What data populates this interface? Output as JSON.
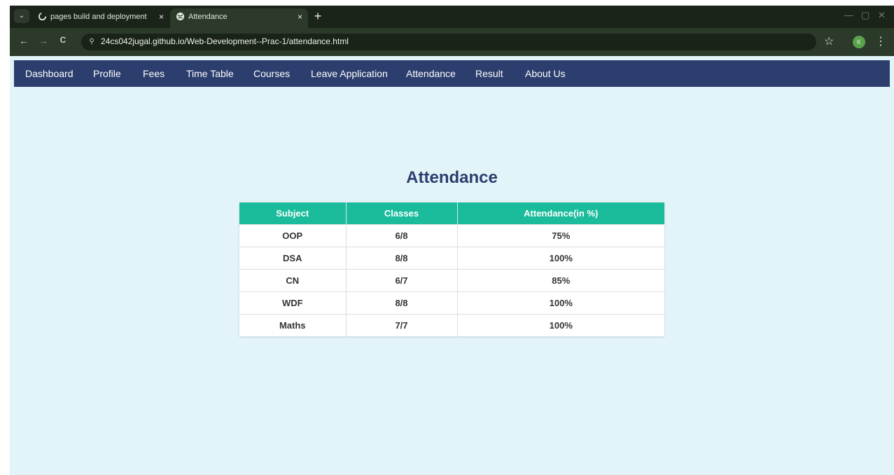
{
  "browser": {
    "tabs": [
      {
        "title": "pages build and deployment · 2",
        "active": false,
        "icon": "github-icon"
      },
      {
        "title": "Attendance",
        "active": true,
        "icon": "globe-icon"
      }
    ],
    "tab_close_glyph": "×",
    "new_tab_glyph": "+",
    "tab_menu_glyph": "⌄",
    "window_controls": {
      "minimize": "—",
      "maximize": "▢",
      "close": "✕"
    },
    "nav": {
      "back": "←",
      "forward": "→",
      "reload": "C"
    },
    "url": "24cs042jugal.github.io/Web-Development--Prac-1/attendance.html",
    "site_info_glyph": "⚲",
    "bookmark_glyph": "☆",
    "profile_initial": "K",
    "menu_glyph": "⋮"
  },
  "site_nav": {
    "items": [
      "Dashboard",
      "Profile",
      "Fees",
      "Time Table",
      "Courses",
      "Leave Application",
      "Attendance",
      "Result",
      "About Us"
    ]
  },
  "page": {
    "title": "Attendance",
    "table": {
      "headers": [
        "Subject",
        "Classes",
        "Attendance(in %)"
      ],
      "rows": [
        [
          "OOP",
          "6/8",
          "75%"
        ],
        [
          "DSA",
          "8/8",
          "100%"
        ],
        [
          "CN",
          "6/7",
          "85%"
        ],
        [
          "WDF",
          "8/8",
          "100%"
        ],
        [
          "Maths",
          "7/7",
          "100%"
        ]
      ]
    }
  },
  "colors": {
    "nav_bg": "#2c3e6e",
    "header_bg": "#1bbc9b",
    "page_bg": "#e3f4f9",
    "title": "#2c3e6e"
  }
}
